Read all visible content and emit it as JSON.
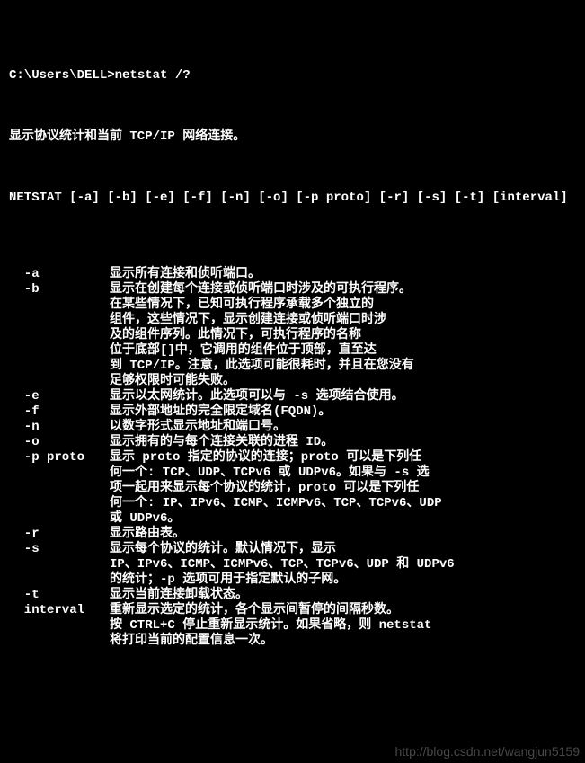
{
  "prompt": "C:\\Users\\DELL>netstat /?",
  "summary": "显示协议统计和当前 TCP/IP 网络连接。",
  "usage": "NETSTAT [-a] [-b] [-e] [-f] [-n] [-o] [-p proto] [-r] [-s] [-t] [interval]",
  "options": [
    {
      "key": "-a",
      "desc": "显示所有连接和侦听端口。"
    },
    {
      "key": "-b",
      "desc": "显示在创建每个连接或侦听端口时涉及的可执行程序。\n在某些情况下，已知可执行程序承载多个独立的\n组件，这些情况下，显示创建连接或侦听端口时涉\n及的组件序列。此情况下，可执行程序的名称\n位于底部[]中，它调用的组件位于顶部，直至达\n到 TCP/IP。注意，此选项可能很耗时，并且在您没有\n足够权限时可能失败。"
    },
    {
      "key": "-e",
      "desc": "显示以太网统计。此选项可以与 -s 选项结合使用。"
    },
    {
      "key": "-f",
      "desc": "显示外部地址的完全限定域名(FQDN)。"
    },
    {
      "key": "-n",
      "desc": "以数字形式显示地址和端口号。"
    },
    {
      "key": "-o",
      "desc": "显示拥有的与每个连接关联的进程 ID。"
    },
    {
      "key": "-p proto",
      "desc": "显示 proto 指定的协议的连接；proto 可以是下列任\n何一个: TCP、UDP、TCPv6 或 UDPv6。如果与 -s 选\n项一起用来显示每个协议的统计，proto 可以是下列任\n何一个: IP、IPv6、ICMP、ICMPv6、TCP、TCPv6、UDP\n或 UDPv6。"
    },
    {
      "key": "-r",
      "desc": "显示路由表。"
    },
    {
      "key": "-s",
      "desc": "显示每个协议的统计。默认情况下，显示\nIP、IPv6、ICMP、ICMPv6、TCP、TCPv6、UDP 和 UDPv6\n的统计；-p 选项可用于指定默认的子网。"
    },
    {
      "key": "-t",
      "desc": "显示当前连接卸载状态。"
    },
    {
      "key": "interval",
      "desc": "重新显示选定的统计，各个显示间暂停的间隔秒数。\n按 CTRL+C 停止重新显示统计。如果省略，则 netstat\n将打印当前的配置信息一次。"
    }
  ],
  "watermark": "http://blog.csdn.net/wangjun5159"
}
